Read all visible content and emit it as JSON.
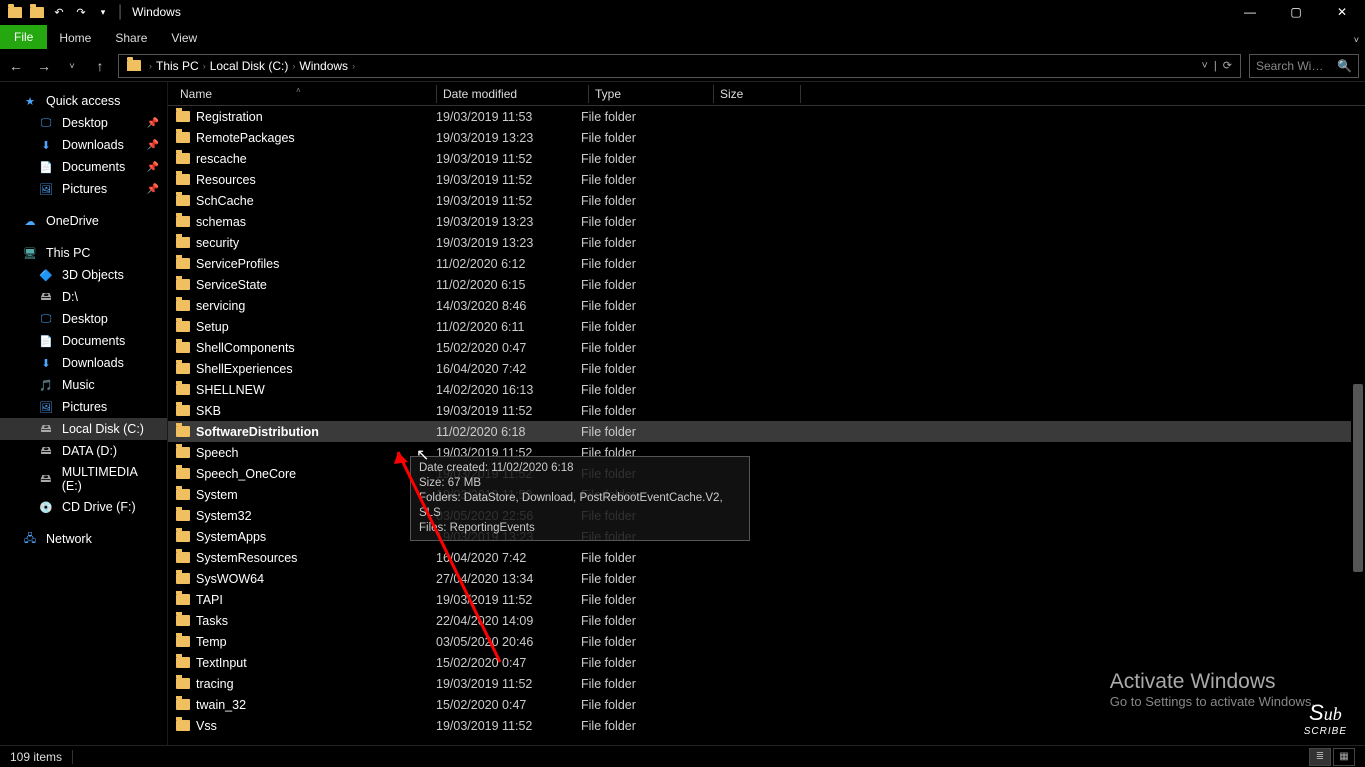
{
  "title": "Windows",
  "ribbon": {
    "file": "File",
    "tabs": [
      "Home",
      "Share",
      "View"
    ]
  },
  "nav": {
    "crumbs": [
      "This PC",
      "Local Disk (C:)",
      "Windows"
    ],
    "search_placeholder": "Search Wi…"
  },
  "sidebar": {
    "quick_access": {
      "label": "Quick access",
      "items": [
        {
          "label": "Desktop",
          "icon": "desktop",
          "pinned": true
        },
        {
          "label": "Downloads",
          "icon": "downloads",
          "pinned": true
        },
        {
          "label": "Documents",
          "icon": "documents",
          "pinned": true
        },
        {
          "label": "Pictures",
          "icon": "pictures",
          "pinned": true
        }
      ]
    },
    "onedrive": {
      "label": "OneDrive"
    },
    "this_pc": {
      "label": "This PC",
      "items": [
        {
          "label": "3D Objects",
          "icon": "3d"
        },
        {
          "label": "D:\\",
          "icon": "drive"
        },
        {
          "label": "Desktop",
          "icon": "desktop"
        },
        {
          "label": "Documents",
          "icon": "documents"
        },
        {
          "label": "Downloads",
          "icon": "downloads"
        },
        {
          "label": "Music",
          "icon": "music"
        },
        {
          "label": "Pictures",
          "icon": "pictures"
        },
        {
          "label": "Local Disk (C:)",
          "icon": "drive",
          "selected": true
        },
        {
          "label": "DATA (D:)",
          "icon": "drive"
        },
        {
          "label": "MULTIMEDIA (E:)",
          "icon": "drive"
        },
        {
          "label": "CD Drive (F:)",
          "icon": "cd"
        }
      ]
    },
    "network": {
      "label": "Network"
    }
  },
  "columns": {
    "name": "Name",
    "date": "Date modified",
    "type": "Type",
    "size": "Size"
  },
  "rows": [
    {
      "name": "Registration",
      "date": "19/03/2019 11:53",
      "type": "File folder"
    },
    {
      "name": "RemotePackages",
      "date": "19/03/2019 13:23",
      "type": "File folder"
    },
    {
      "name": "rescache",
      "date": "19/03/2019 11:52",
      "type": "File folder"
    },
    {
      "name": "Resources",
      "date": "19/03/2019 11:52",
      "type": "File folder"
    },
    {
      "name": "SchCache",
      "date": "19/03/2019 11:52",
      "type": "File folder"
    },
    {
      "name": "schemas",
      "date": "19/03/2019 13:23",
      "type": "File folder"
    },
    {
      "name": "security",
      "date": "19/03/2019 13:23",
      "type": "File folder"
    },
    {
      "name": "ServiceProfiles",
      "date": "11/02/2020 6:12",
      "type": "File folder"
    },
    {
      "name": "ServiceState",
      "date": "11/02/2020 6:15",
      "type": "File folder"
    },
    {
      "name": "servicing",
      "date": "14/03/2020 8:46",
      "type": "File folder"
    },
    {
      "name": "Setup",
      "date": "11/02/2020 6:11",
      "type": "File folder"
    },
    {
      "name": "ShellComponents",
      "date": "15/02/2020 0:47",
      "type": "File folder"
    },
    {
      "name": "ShellExperiences",
      "date": "16/04/2020 7:42",
      "type": "File folder"
    },
    {
      "name": "SHELLNEW",
      "date": "14/02/2020 16:13",
      "type": "File folder"
    },
    {
      "name": "SKB",
      "date": "19/03/2019 11:52",
      "type": "File folder"
    },
    {
      "name": "SoftwareDistribution",
      "date": "11/02/2020 6:18",
      "type": "File folder",
      "selected": true,
      "bold": true
    },
    {
      "name": "Speech",
      "date": "19/03/2019 11:52",
      "type": "File folder"
    },
    {
      "name": "Speech_OneCore",
      "date": "19/03/2019 11:52",
      "type": "File folder"
    },
    {
      "name": "System",
      "date": "19/03/2019 11:52",
      "type": "File folder"
    },
    {
      "name": "System32",
      "date": "03/05/2020 22:56",
      "type": "File folder"
    },
    {
      "name": "SystemApps",
      "date": "19/03/2019 13:23",
      "type": "File folder"
    },
    {
      "name": "SystemResources",
      "date": "16/04/2020 7:42",
      "type": "File folder"
    },
    {
      "name": "SysWOW64",
      "date": "27/04/2020 13:34",
      "type": "File folder"
    },
    {
      "name": "TAPI",
      "date": "19/03/2019 11:52",
      "type": "File folder"
    },
    {
      "name": "Tasks",
      "date": "22/04/2020 14:09",
      "type": "File folder"
    },
    {
      "name": "Temp",
      "date": "03/05/2020 20:46",
      "type": "File folder"
    },
    {
      "name": "TextInput",
      "date": "15/02/2020 0:47",
      "type": "File folder"
    },
    {
      "name": "tracing",
      "date": "19/03/2019 11:52",
      "type": "File folder"
    },
    {
      "name": "twain_32",
      "date": "15/02/2020 0:47",
      "type": "File folder"
    },
    {
      "name": "Vss",
      "date": "19/03/2019 11:52",
      "type": "File folder"
    }
  ],
  "tooltip": {
    "line1": "Date created: 11/02/2020 6:18",
    "line2": "Size: 67 MB",
    "line3": "Folders: DataStore, Download, PostRebootEventCache.V2, SLS",
    "line4": "Files: ReportingEvents"
  },
  "status": {
    "count": "109 items"
  },
  "watermark": {
    "title": "Activate Windows",
    "sub": "Go to Settings to activate Windows."
  },
  "subscribe": "Sub\nscribe"
}
